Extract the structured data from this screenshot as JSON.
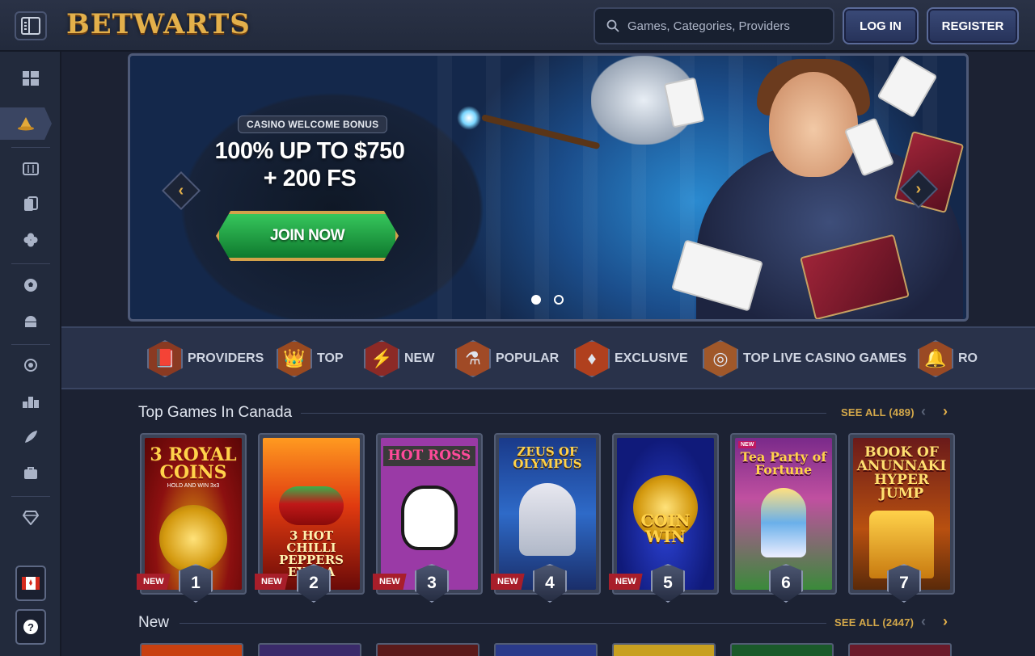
{
  "header": {
    "logo_text": "BETWARTS",
    "search_placeholder": "Games, Categories, Providers",
    "login_label": "LOG IN",
    "register_label": "REGISTER"
  },
  "sidebar": {
    "items": [
      {
        "icon": "grid-icon"
      },
      {
        "icon": "wizard-hat-icon",
        "active": true
      },
      {
        "icon": "slot-machine-icon"
      },
      {
        "icon": "cards-icon"
      },
      {
        "icon": "clover-icon"
      },
      {
        "icon": "soccer-ball-icon"
      },
      {
        "icon": "live-tv-icon"
      },
      {
        "icon": "award-icon"
      },
      {
        "icon": "leaderboard-icon"
      },
      {
        "icon": "rocket-icon"
      },
      {
        "icon": "shop-bag-icon"
      },
      {
        "icon": "diamond-icon"
      }
    ],
    "country_flag": "canada-flag-icon",
    "help_icon": "help-icon"
  },
  "banner": {
    "tag": "CASINO WELCOME BONUS",
    "line1": "100% UP TO $750",
    "line2": "+ 200 FS",
    "cta": "JOIN NOW",
    "slides": 2,
    "active_slide": 1
  },
  "categories": [
    {
      "label": "PROVIDERS",
      "icon": "book-icon"
    },
    {
      "label": "TOP",
      "icon": "crown-icon"
    },
    {
      "label": "NEW",
      "icon": "lightning-icon"
    },
    {
      "label": "POPULAR",
      "icon": "potion-icon"
    },
    {
      "label": "EXCLUSIVE",
      "icon": "gem-icon"
    },
    {
      "label": "TOP LIVE CASINO GAMES",
      "icon": "chip-icon"
    },
    {
      "label": "RO",
      "icon": "bell-icon"
    }
  ],
  "sections": {
    "top": {
      "title": "Top Games In Canada",
      "see_all": "SEE ALL (489)"
    },
    "new": {
      "title": "New",
      "see_all": "SEE ALL (2447)"
    }
  },
  "games": [
    {
      "title": "3 ROYAL COINS",
      "subtitle": "HOLD AND WIN 3x3",
      "rank": "1",
      "badge": "NEW"
    },
    {
      "title": "3 HOT CHILLI PEPPERS EXTRA",
      "rank": "2",
      "badge": "NEW"
    },
    {
      "title": "HOT ROSS",
      "rank": "3",
      "badge": "NEW"
    },
    {
      "title": "ZEUS OF OLYMPUS",
      "rank": "4",
      "badge": "NEW"
    },
    {
      "title": "COIN WIN",
      "rank": "5",
      "badge": "NEW"
    },
    {
      "title": "Tea Party of Fortune",
      "corner": "NEW",
      "rank": "6"
    },
    {
      "title": "BOOK OF ANUNNAKI HYPER JUMP",
      "rank": "7"
    }
  ],
  "colors": {
    "accent_gold": "#e3b04b",
    "bg": "#1c2233",
    "new_badge": "#a81e2a",
    "cta_green": "#1fa845"
  }
}
